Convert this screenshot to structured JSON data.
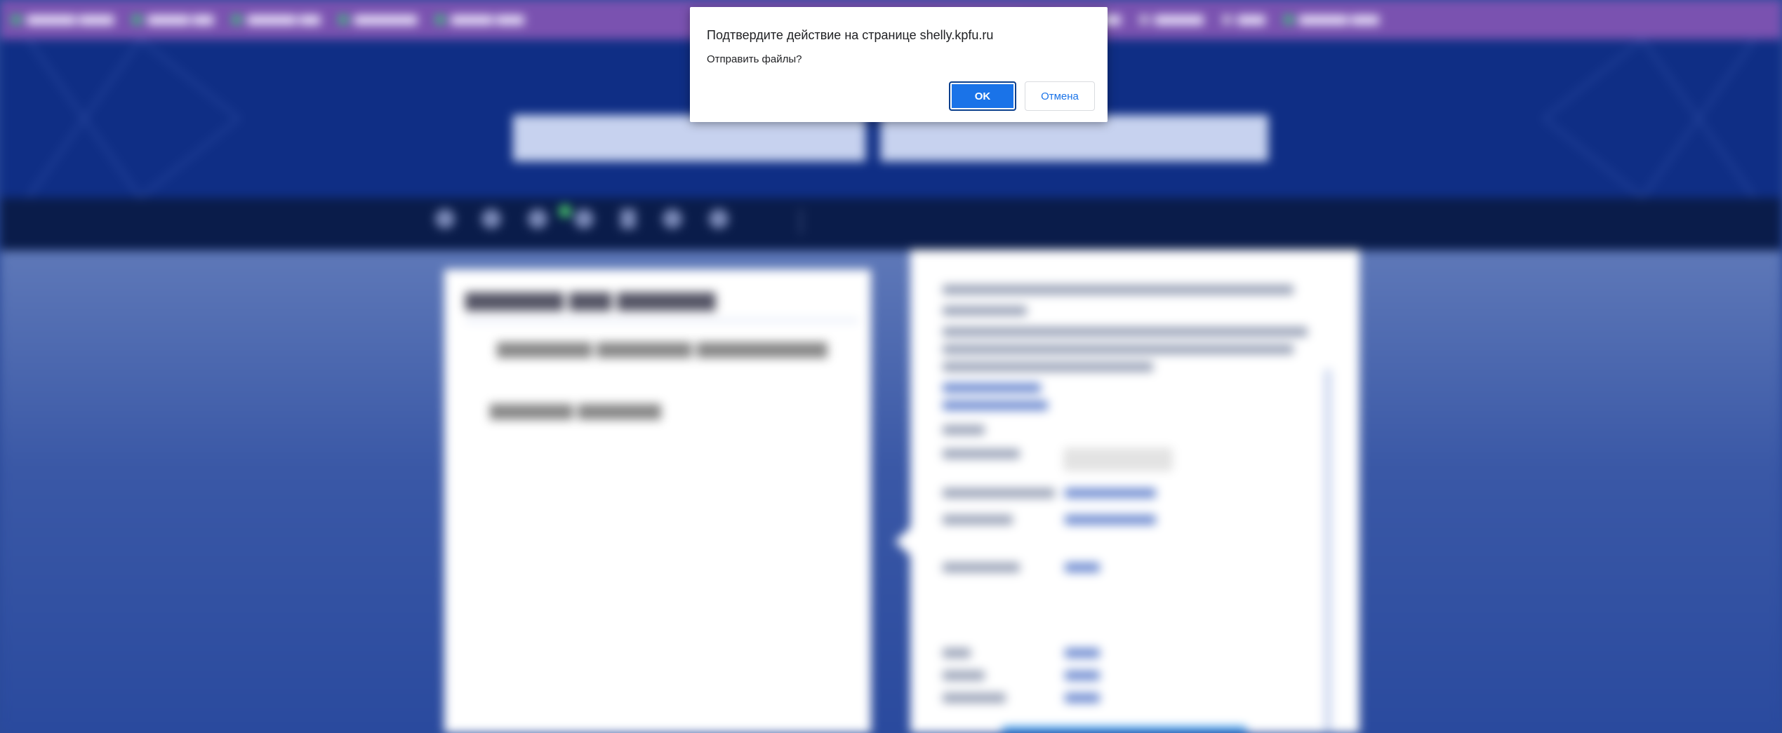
{
  "dialog": {
    "title": "Подтвердите действие на странице shelly.kpfu.ru",
    "message": "Отправить файлы?",
    "ok_label": "OK",
    "cancel_label": "Отмена"
  },
  "colors": {
    "bookmarks_bar": "#7a52b0",
    "banner": "#0f2e85",
    "navbar": "#0a1c4a",
    "accent": "#1a73e8"
  },
  "icons": {
    "nav": [
      "back-icon",
      "user-icon",
      "messages-icon",
      "settings-icon",
      "documents-icon",
      "globe-icon",
      "search-icon"
    ]
  }
}
